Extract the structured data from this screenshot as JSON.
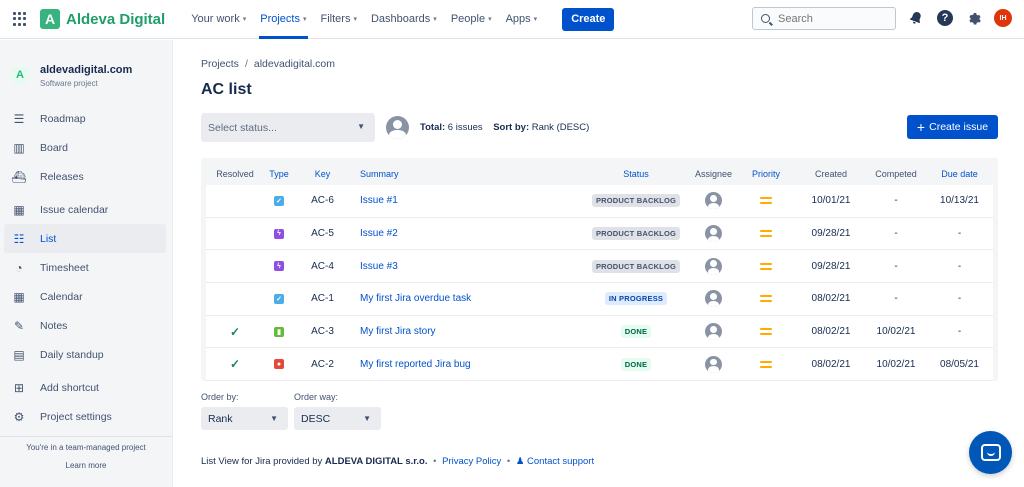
{
  "topnav": {
    "logo_letter": "A",
    "app_name": "Aldeva Digital",
    "items": [
      {
        "label": "Your work",
        "chevron": "▾"
      },
      {
        "label": "Projects",
        "chevron": "▾",
        "active": true
      },
      {
        "label": "Filters",
        "chevron": "▾"
      },
      {
        "label": "Dashboards",
        "chevron": "▾"
      },
      {
        "label": "People",
        "chevron": "▾"
      },
      {
        "label": "Apps",
        "chevron": "▾"
      }
    ],
    "create_label": "Create",
    "search_placeholder": "Search",
    "user_initials": "IH",
    "icons": [
      "app-switcher-icon",
      "notifications-icon",
      "help-icon",
      "settings-icon"
    ]
  },
  "sidebar": {
    "project_letter": "A",
    "project_name": "aldevadigital.com",
    "project_type": "Software project",
    "items": [
      {
        "label": "Roadmap",
        "icon": "roadmap-icon"
      },
      {
        "label": "Board",
        "icon": "board-icon"
      },
      {
        "label": "Releases",
        "icon": "releases-icon"
      },
      {
        "label": "Issue calendar",
        "icon": "calendar-icon"
      },
      {
        "label": "List",
        "icon": "list-icon",
        "active": true
      },
      {
        "label": "Timesheet",
        "icon": "timesheet-icon"
      },
      {
        "label": "Calendar",
        "icon": "calendar-icon"
      },
      {
        "label": "Notes",
        "icon": "notes-icon"
      },
      {
        "label": "Daily standup",
        "icon": "standup-icon"
      },
      {
        "label": "Add shortcut",
        "icon": "add-shortcut-icon"
      },
      {
        "label": "Project settings",
        "icon": "gear-icon"
      }
    ],
    "footer_text": "You're in a team-managed project",
    "footer_link": "Learn more"
  },
  "main": {
    "breadcrumb": [
      "Projects",
      "aldevadigital.com"
    ],
    "breadcrumb_sep": "/",
    "title": "AC list",
    "status_placeholder": "Select status...",
    "total_label": "Total:",
    "total_value": "6 issues",
    "sort_label": "Sort by:",
    "sort_value": "Rank (DESC)",
    "create_issue_label": "Create issue",
    "columns": {
      "resolved": "Resolved",
      "type": "Type",
      "key": "Key",
      "summary": "Summary",
      "status": "Status",
      "assignee": "Assignee",
      "priority": "Priority",
      "created": "Created",
      "completed": "Competed",
      "due": "Due date"
    },
    "rows": [
      {
        "resolved": "",
        "type": "task",
        "key": "AC-6",
        "summary": "Issue #1",
        "status": "PRODUCT BACKLOG",
        "status_color": "gray",
        "created": "10/01/21",
        "completed": "-",
        "due": "10/13/21"
      },
      {
        "resolved": "",
        "type": "subtask",
        "key": "AC-5",
        "summary": "Issue #2",
        "status": "PRODUCT BACKLOG",
        "status_color": "gray",
        "created": "09/28/21",
        "completed": "-",
        "due": "-"
      },
      {
        "resolved": "",
        "type": "subtask",
        "key": "AC-4",
        "summary": "Issue #3",
        "status": "PRODUCT BACKLOG",
        "status_color": "gray",
        "created": "09/28/21",
        "completed": "-",
        "due": "-"
      },
      {
        "resolved": "",
        "type": "task",
        "key": "AC-1",
        "summary": "My first Jira overdue task",
        "status": "IN PROGRESS",
        "status_color": "blue",
        "created": "08/02/21",
        "completed": "-",
        "due": "-"
      },
      {
        "resolved": "✓",
        "type": "story",
        "key": "AC-3",
        "summary": "My first Jira story",
        "status": "DONE",
        "status_color": "green",
        "created": "08/02/21",
        "completed": "10/02/21",
        "due": "-"
      },
      {
        "resolved": "✓",
        "type": "bug",
        "key": "AC-2",
        "summary": "My first reported Jira bug",
        "status": "DONE",
        "status_color": "green",
        "created": "08/02/21",
        "completed": "10/02/21",
        "due": "08/05/21"
      }
    ],
    "order_by_label": "Order by:",
    "order_by_value": "Rank",
    "order_way_label": "Order way:",
    "order_way_value": "DESC"
  },
  "footer": {
    "product": "List View for Jira",
    "provided_by": "provided by",
    "company": "ALDEVA DIGITAL s.r.o.",
    "privacy": "Privacy Policy",
    "support": "Contact support"
  },
  "colors": {
    "brand_green": "#36b37e",
    "primary_blue": "#0052cc",
    "priority_medium": "#ffab00"
  }
}
